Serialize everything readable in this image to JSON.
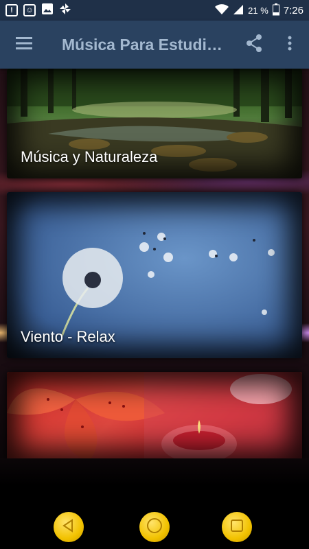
{
  "status_bar": {
    "battery_pct": "21 %",
    "time": "7:26"
  },
  "app_bar": {
    "title": "Música Para Estudi…"
  },
  "cards": [
    {
      "label": "Música y Naturaleza"
    },
    {
      "label": "Viento - Relax"
    },
    {
      "label": ""
    }
  ],
  "colors": {
    "status_bar_bg": "#1f3048",
    "app_bar_bg": "#2a4260",
    "nav_button": "#f2c200"
  }
}
